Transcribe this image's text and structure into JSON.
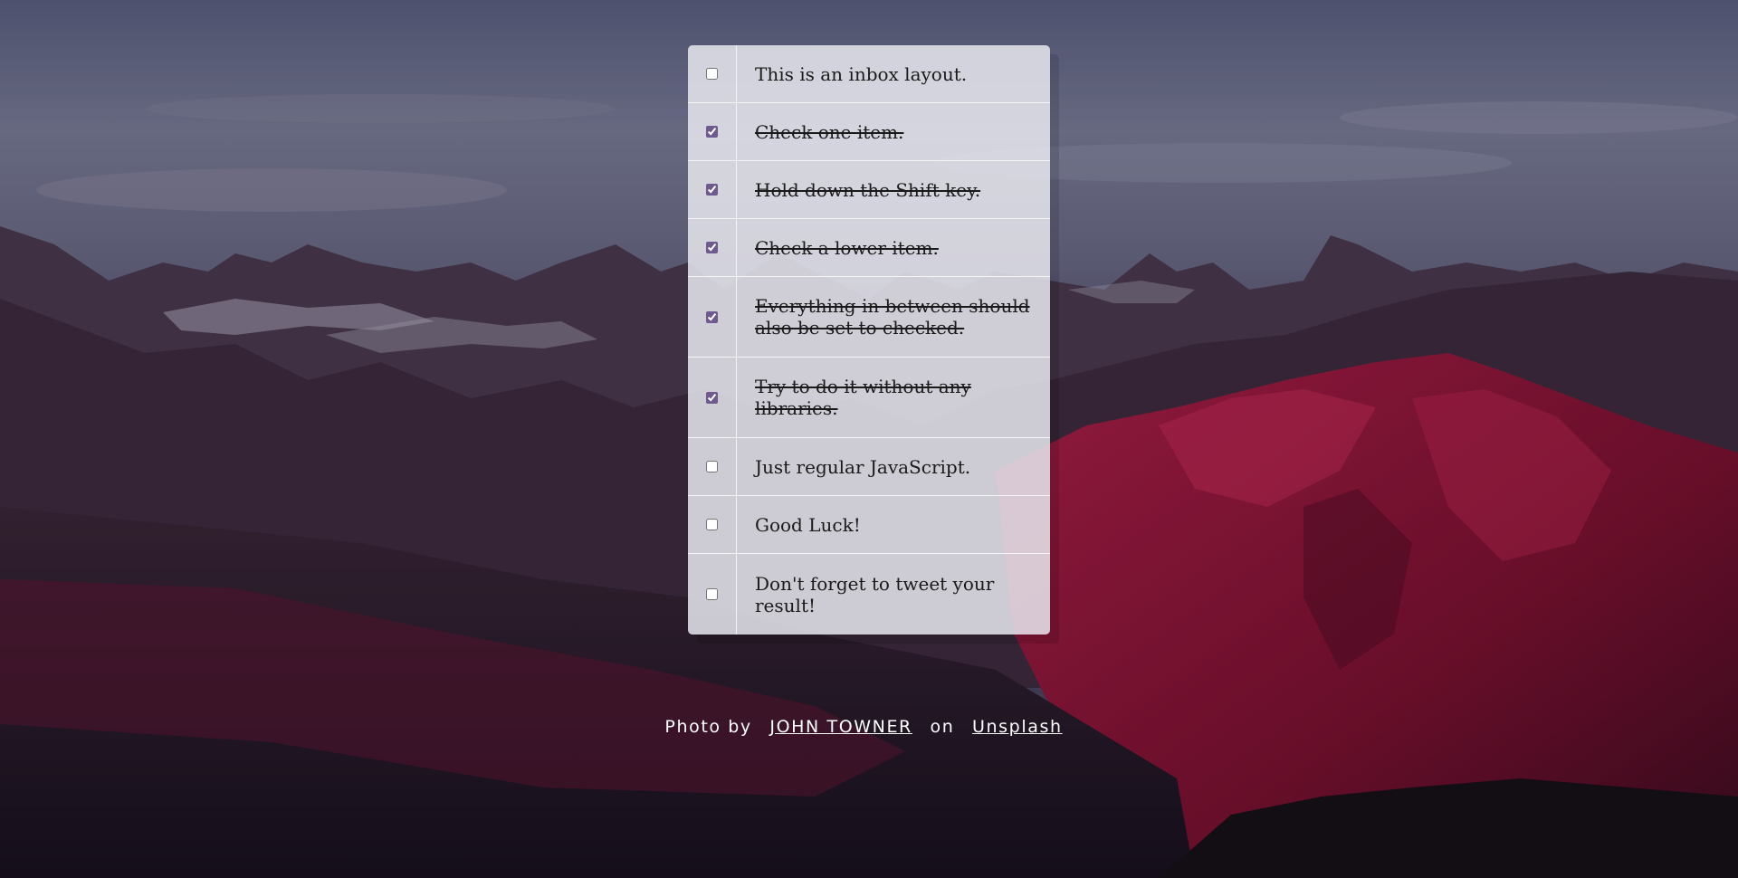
{
  "inbox": {
    "items": [
      {
        "label": "This is an inbox layout.",
        "checked": false
      },
      {
        "label": "Check one item.",
        "checked": true
      },
      {
        "label": "Hold down the Shift key.",
        "checked": true
      },
      {
        "label": "Check a lower item.",
        "checked": true
      },
      {
        "label": "Everything in between should also be set to checked.",
        "checked": true
      },
      {
        "label": "Try to do it without any libraries.",
        "checked": true
      },
      {
        "label": "Just regular JavaScript.",
        "checked": false
      },
      {
        "label": "Good Luck!",
        "checked": false
      },
      {
        "label": "Don't forget to tweet your result!",
        "checked": false
      }
    ]
  },
  "credit": {
    "prefix": "Photo by",
    "author": "JOHN TOWNER",
    "middle": "on",
    "site": "Unsplash"
  },
  "colors": {
    "checkbox_accent": "#6e5a8e",
    "panel": "#e6e6ee",
    "sky": "#6e7390",
    "mountain_red": "#a8153e"
  }
}
